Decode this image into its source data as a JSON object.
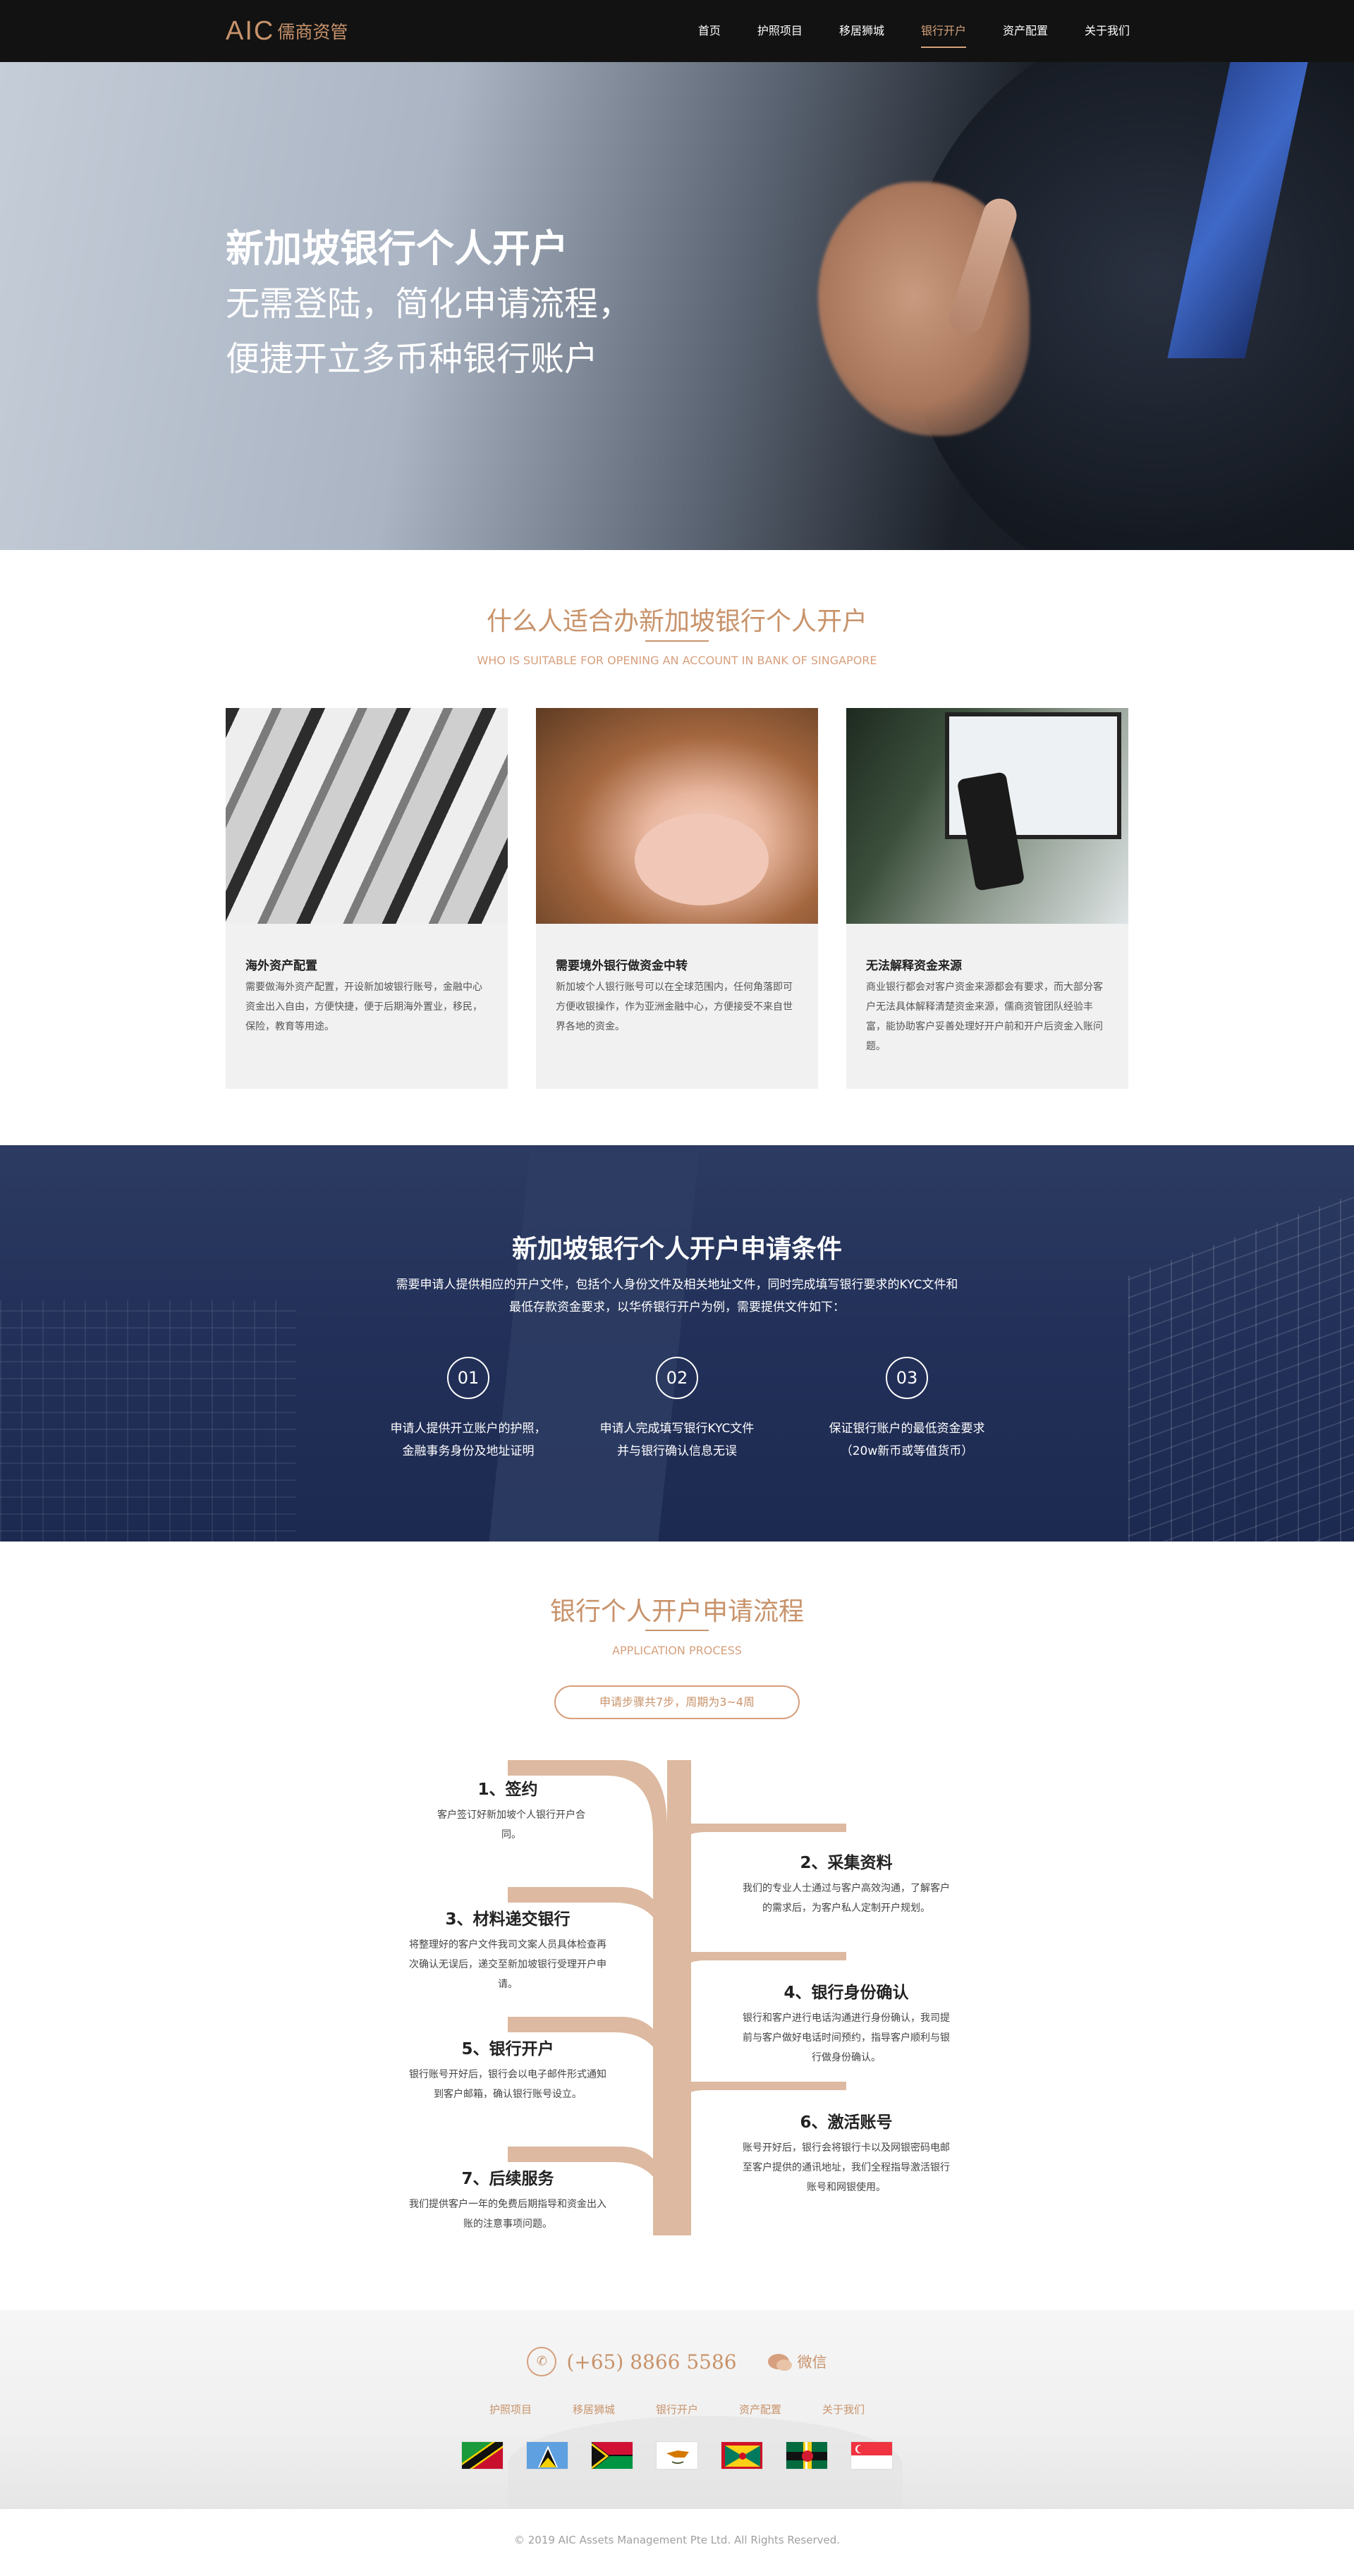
{
  "nav": {
    "logo_aic": "AIC",
    "logo_cn": "儒商资管",
    "items": [
      {
        "label": "首页"
      },
      {
        "label": "护照项目"
      },
      {
        "label": "移居狮城"
      },
      {
        "label": "银行开户",
        "active": true
      },
      {
        "label": "资产配置"
      },
      {
        "label": "关于我们"
      }
    ]
  },
  "hero": {
    "title": "新加坡银行个人开户",
    "line1": "无需登陆，简化申请流程，",
    "line2": "便捷开立多币种银行账户"
  },
  "who": {
    "title": "什么人适合办新加坡银行个人开户",
    "subtitle_en": "WHO IS SUITABLE FOR OPENING AN ACCOUNT IN BANK OF SINGAPORE",
    "cards": [
      {
        "title": "海外资产配置",
        "text": "需要做海外资产配置，开设新加坡银行账号，金融中心资金出入自由，方便快捷，便于后期海外置业，移民，保险，教育等用途。"
      },
      {
        "title": "需要境外银行做资金中转",
        "text": "新加坡个人银行账号可以在全球范围内，任何角落即可方便收银操作，作为亚洲金融中心，方便接受不来自世界各地的资金。"
      },
      {
        "title": "无法解释资金来源",
        "text": "商业银行都会对客户资金来源都会有要求，而大部分客户无法具体解释清楚资金来源，儒商资管团队经验丰富，能协助客户妥善处理好开户前和开户后资金入账问题。"
      }
    ]
  },
  "conditions": {
    "title": "新加坡银行个人开户申请条件",
    "desc": "需要申请人提供相应的开户文件，包括个人身份文件及相关地址文件，同时完成填写银行要求的KYC文件和最低存款资金要求，以华侨银行开户为例，需要提供文件如下：",
    "steps": [
      {
        "num": "01",
        "line1": "申请人提供开立账户的护照，",
        "line2": "金融事务身份及地址证明"
      },
      {
        "num": "02",
        "line1": "申请人完成填写银行KYC文件",
        "line2": "并与银行确认信息无误"
      },
      {
        "num": "03",
        "line1": "保证银行账户的最低资金要求",
        "line2": "（20w新币或等值货币）"
      }
    ]
  },
  "process": {
    "title": "银行个人开户申请流程",
    "subtitle_en": "APPLICATION PROCESS",
    "pill": "申请步骤共7步，周期为3~4周",
    "steps": [
      {
        "title": "1、签约",
        "text": "客户签订好新加坡个人银行开户合同。"
      },
      {
        "title": "2、采集资料",
        "text": "我们的专业人士通过与客户高效沟通，了解客户的需求后，为客户私人定制开户规划。"
      },
      {
        "title": "3、材料递交银行",
        "text": "将整理好的客户文件我司文案人员具体检查再次确认无误后，递交至新加坡银行受理开户申请。"
      },
      {
        "title": "4、银行身份确认",
        "text": "银行和客户进行电话沟通进行身份确认，我司提前与客户做好电话时间预约，指导客户顺利与银行做身份确认。"
      },
      {
        "title": "5、银行开户",
        "text": "银行账号开好后，银行会以电子邮件形式通知到客户邮箱，确认银行账号设立。"
      },
      {
        "title": "6、激活账号",
        "text": "账号开好后，银行会将银行卡以及网银密码电邮至客户提供的通讯地址，我们全程指导激活银行账号和网银使用。"
      },
      {
        "title": "7、后续服务",
        "text": "我们提供客户一年的免费后期指导和资金出入账的注意事项问题。"
      }
    ]
  },
  "footer": {
    "phone": "(+65) 8866 5586",
    "wechat": "微信",
    "links": [
      "护照项目",
      "移居狮城",
      "银行开户",
      "资产配置",
      "关于我们"
    ],
    "flags": [
      "st-kitts-nevis-flag",
      "saint-lucia-flag",
      "vanuatu-flag",
      "cyprus-flag",
      "grenada-flag",
      "dominica-flag",
      "singapore-flag"
    ],
    "copyright": "© 2019 AIC Assets Management Pte Ltd. All Rights Reserved."
  },
  "colors": {
    "accent": "#c8936b",
    "nav_bg": "#121212",
    "navy": "#23315a"
  }
}
